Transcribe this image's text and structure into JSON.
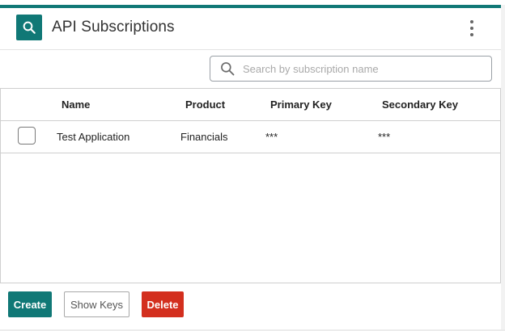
{
  "header": {
    "title": "API Subscriptions",
    "icon": "search-icon",
    "menu_icon": "kebab-menu-icon",
    "accent_color": "#107876"
  },
  "search": {
    "placeholder": "Search by subscription name",
    "value": ""
  },
  "table": {
    "columns": [
      "Name",
      "Product",
      "Primary Key",
      "Secondary Key"
    ],
    "rows": [
      {
        "checked": false,
        "name": "Test Application",
        "product": "Financials",
        "primary_key": "***",
        "secondary_key": "***"
      }
    ]
  },
  "actions": {
    "create_label": "Create",
    "show_keys_label": "Show Keys",
    "delete_label": "Delete",
    "create_color": "#107876",
    "delete_color": "#d32f1e"
  }
}
